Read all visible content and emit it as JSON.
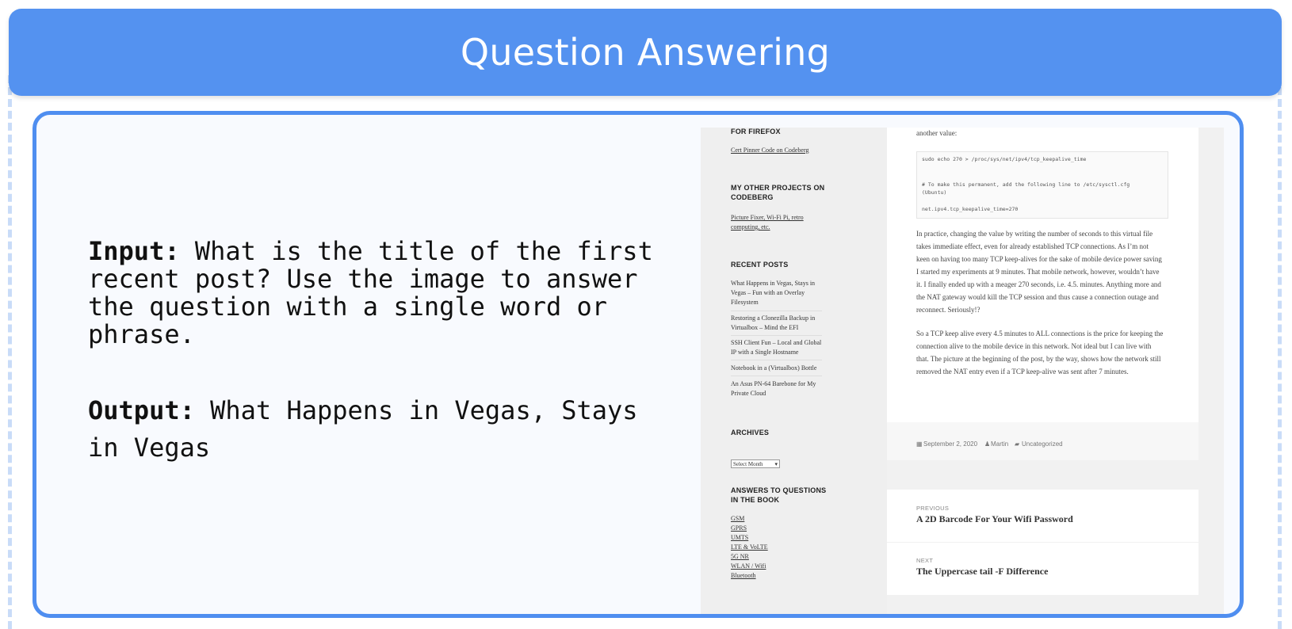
{
  "header": {
    "title": "Question Answering"
  },
  "qa": {
    "input_label": "Input:",
    "input_text": " What is the title of the first recent post? Use the image to answer the question with a single word or phrase.",
    "output_label": "Output:",
    "output_text": " What Happens in Vegas, Stays in Vegas"
  },
  "screenshot": {
    "sidebar": {
      "firefox_heading": "FOR FIREFOX",
      "firefox_link": "Cert Pinner Code on Codeberg",
      "projects_heading_1": "MY OTHER PROJECTS ON",
      "projects_heading_2": "CODEBERG",
      "projects_link_1": "Picture Fixer, Wi-Fi Pi, retro",
      "projects_link_2": "computing, etc.",
      "recent_heading": "RECENT POSTS",
      "recent_posts": [
        "What Happens in Vegas, Stays in Vegas – Fun with an Overlay Filesystem",
        "Restoring a Clonezilla Backup in Virtualbox – Mind the EFI",
        "SSH Client Fun – Local and Global IP with a Single Hostname",
        "Notebook in a (Virtualbox) Bottle",
        "An Asus PN-64 Barebone for My Private Cloud"
      ],
      "archives_heading": "ARCHIVES",
      "archives_select": "Select Month",
      "answers_heading_1": "ANSWERS TO QUESTIONS",
      "answers_heading_2": "IN THE BOOK",
      "answers_links": [
        "GSM",
        "GPRS",
        "UMTS",
        "LTE & VoLTE",
        "5G NR",
        "WLAN / Wifi",
        "Bluetooth"
      ]
    },
    "article": {
      "intro": "another value:",
      "code_1": "sudo echo 270 > /proc/sys/net/ipv4/tcp_keepalive_time",
      "code_2": "# To make this permanent, add the following line to /etc/sysctl.cfg",
      "code_3": "(Ubuntu)",
      "code_4": "net.ipv4.tcp_keepalive_time=270",
      "para_1": "In practice, changing the value by writing the number of seconds to this virtual file takes immediate effect, even for already established TCP connections. As I’m not keen on having too many TCP keep-alives for the sake of mobile device power saving I started my experiments at 9 minutes. That mobile network, however, wouldn’t have it. I finally ended up with a meager 270 seconds, i.e. 4.5. minutes. Anything more and the NAT gateway would kill the TCP session and thus cause a connection outage and reconnect. Seriously!?",
      "para_2": "So a TCP keep alive every 4.5 minutes to ALL connections is the price for keeping the connection alive to the mobile device in this network. Not ideal but I can live with that. The picture at the beginning of the post, by the way, shows how the network still removed the NAT entry even if a TCP keep-alive was sent after 7 minutes.",
      "date": "September 2, 2020",
      "author": "Martin",
      "category": "Uncategorized"
    },
    "post_nav": {
      "previous_label": "PREVIOUS",
      "previous_title": "A 2D Barcode For Your Wifi Password",
      "next_label": "NEXT",
      "next_title": "The Uppercase tail -F Difference"
    }
  }
}
